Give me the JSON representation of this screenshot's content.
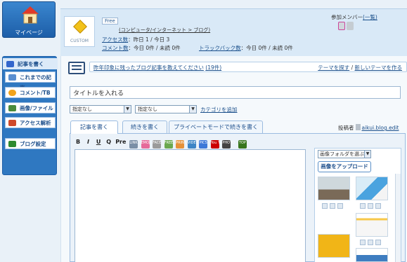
{
  "sidebar": {
    "mypage_label": "マイページ",
    "items": [
      {
        "label": "記事を書く",
        "icon": "pencil-icon",
        "color": "#3366cc"
      },
      {
        "label": "これまでの記事",
        "icon": "document-icon",
        "color": "#5b8fd0"
      },
      {
        "label": "コメント/TB",
        "icon": "comment-icon",
        "color": "#f2a31b"
      },
      {
        "label": "画像/ファイル",
        "icon": "image-icon",
        "color": "#4a8b3c"
      },
      {
        "label": "アクセス解析",
        "icon": "chart-icon",
        "color": "#d04a2a"
      },
      {
        "label": "ブログ設定",
        "icon": "wrench-icon",
        "color": "#2f8a2f"
      }
    ]
  },
  "header": {
    "logo_text": "CUSTOM",
    "plan_badge": "Free",
    "category_link": "(コンピュータ/インターネット > ブログ)",
    "access_label": "アクセス数",
    "access_value": "：昨日 1 / 今日 3",
    "comment_label": "コメント数",
    "comment_value": "：今日 0件 / 未読 0件",
    "trackback_label": "トラックバック数",
    "trackback_value": "：今日 0件 / 未読 0件",
    "members_label": "参加メンバー",
    "members_list_link": "(一覧)"
  },
  "theme_bar": {
    "prompt_link": "昨年印象に残ったブログ記事を教えてください",
    "count": "(19件)",
    "find_theme": "テーマを探す",
    "new_theme": "新しいテーマを作る"
  },
  "editor": {
    "title_value": "タイトルを入れる",
    "category_select_1": "指定なし",
    "category_select_2": "指定なし",
    "category_add_link": "カテゴリを追加",
    "tabs": [
      {
        "label": "記事を書く"
      },
      {
        "label": "続きを書く"
      },
      {
        "label": "プライベートモードで続きを書く"
      }
    ],
    "poster_label": "投稿者",
    "poster_name": "aikui.blog.edit",
    "toolbar": {
      "bold": "B",
      "italic": "I",
      "underline": "U",
      "quote": "Q",
      "pre": "Pre",
      "icons": [
        "LINK",
        "EMOJI",
        "FACE",
        "FREE",
        "PRINT",
        "VIDEO",
        "PICS",
        "You Tube",
        "PHOTO",
        "TOP"
      ]
    },
    "image_panel": {
      "folder_select": "画像フォルダを選ぶ",
      "upload_button": "画像をアップロード"
    }
  }
}
